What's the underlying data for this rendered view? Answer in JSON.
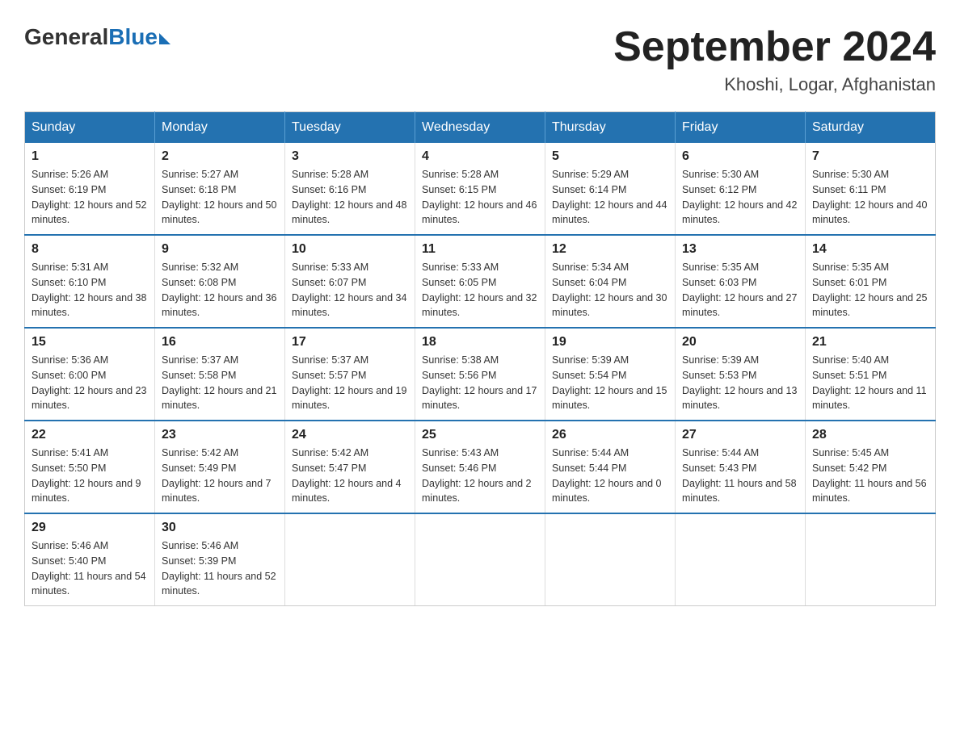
{
  "logo": {
    "general": "General",
    "blue": "Blue"
  },
  "title": {
    "month_year": "September 2024",
    "location": "Khoshi, Logar, Afghanistan"
  },
  "days_header": [
    "Sunday",
    "Monday",
    "Tuesday",
    "Wednesday",
    "Thursday",
    "Friday",
    "Saturday"
  ],
  "weeks": [
    [
      {
        "day": "1",
        "sunrise": "5:26 AM",
        "sunset": "6:19 PM",
        "daylight": "12 hours and 52 minutes."
      },
      {
        "day": "2",
        "sunrise": "5:27 AM",
        "sunset": "6:18 PM",
        "daylight": "12 hours and 50 minutes."
      },
      {
        "day": "3",
        "sunrise": "5:28 AM",
        "sunset": "6:16 PM",
        "daylight": "12 hours and 48 minutes."
      },
      {
        "day": "4",
        "sunrise": "5:28 AM",
        "sunset": "6:15 PM",
        "daylight": "12 hours and 46 minutes."
      },
      {
        "day": "5",
        "sunrise": "5:29 AM",
        "sunset": "6:14 PM",
        "daylight": "12 hours and 44 minutes."
      },
      {
        "day": "6",
        "sunrise": "5:30 AM",
        "sunset": "6:12 PM",
        "daylight": "12 hours and 42 minutes."
      },
      {
        "day": "7",
        "sunrise": "5:30 AM",
        "sunset": "6:11 PM",
        "daylight": "12 hours and 40 minutes."
      }
    ],
    [
      {
        "day": "8",
        "sunrise": "5:31 AM",
        "sunset": "6:10 PM",
        "daylight": "12 hours and 38 minutes."
      },
      {
        "day": "9",
        "sunrise": "5:32 AM",
        "sunset": "6:08 PM",
        "daylight": "12 hours and 36 minutes."
      },
      {
        "day": "10",
        "sunrise": "5:33 AM",
        "sunset": "6:07 PM",
        "daylight": "12 hours and 34 minutes."
      },
      {
        "day": "11",
        "sunrise": "5:33 AM",
        "sunset": "6:05 PM",
        "daylight": "12 hours and 32 minutes."
      },
      {
        "day": "12",
        "sunrise": "5:34 AM",
        "sunset": "6:04 PM",
        "daylight": "12 hours and 30 minutes."
      },
      {
        "day": "13",
        "sunrise": "5:35 AM",
        "sunset": "6:03 PM",
        "daylight": "12 hours and 27 minutes."
      },
      {
        "day": "14",
        "sunrise": "5:35 AM",
        "sunset": "6:01 PM",
        "daylight": "12 hours and 25 minutes."
      }
    ],
    [
      {
        "day": "15",
        "sunrise": "5:36 AM",
        "sunset": "6:00 PM",
        "daylight": "12 hours and 23 minutes."
      },
      {
        "day": "16",
        "sunrise": "5:37 AM",
        "sunset": "5:58 PM",
        "daylight": "12 hours and 21 minutes."
      },
      {
        "day": "17",
        "sunrise": "5:37 AM",
        "sunset": "5:57 PM",
        "daylight": "12 hours and 19 minutes."
      },
      {
        "day": "18",
        "sunrise": "5:38 AM",
        "sunset": "5:56 PM",
        "daylight": "12 hours and 17 minutes."
      },
      {
        "day": "19",
        "sunrise": "5:39 AM",
        "sunset": "5:54 PM",
        "daylight": "12 hours and 15 minutes."
      },
      {
        "day": "20",
        "sunrise": "5:39 AM",
        "sunset": "5:53 PM",
        "daylight": "12 hours and 13 minutes."
      },
      {
        "day": "21",
        "sunrise": "5:40 AM",
        "sunset": "5:51 PM",
        "daylight": "12 hours and 11 minutes."
      }
    ],
    [
      {
        "day": "22",
        "sunrise": "5:41 AM",
        "sunset": "5:50 PM",
        "daylight": "12 hours and 9 minutes."
      },
      {
        "day": "23",
        "sunrise": "5:42 AM",
        "sunset": "5:49 PM",
        "daylight": "12 hours and 7 minutes."
      },
      {
        "day": "24",
        "sunrise": "5:42 AM",
        "sunset": "5:47 PM",
        "daylight": "12 hours and 4 minutes."
      },
      {
        "day": "25",
        "sunrise": "5:43 AM",
        "sunset": "5:46 PM",
        "daylight": "12 hours and 2 minutes."
      },
      {
        "day": "26",
        "sunrise": "5:44 AM",
        "sunset": "5:44 PM",
        "daylight": "12 hours and 0 minutes."
      },
      {
        "day": "27",
        "sunrise": "5:44 AM",
        "sunset": "5:43 PM",
        "daylight": "11 hours and 58 minutes."
      },
      {
        "day": "28",
        "sunrise": "5:45 AM",
        "sunset": "5:42 PM",
        "daylight": "11 hours and 56 minutes."
      }
    ],
    [
      {
        "day": "29",
        "sunrise": "5:46 AM",
        "sunset": "5:40 PM",
        "daylight": "11 hours and 54 minutes."
      },
      {
        "day": "30",
        "sunrise": "5:46 AM",
        "sunset": "5:39 PM",
        "daylight": "11 hours and 52 minutes."
      },
      null,
      null,
      null,
      null,
      null
    ]
  ]
}
